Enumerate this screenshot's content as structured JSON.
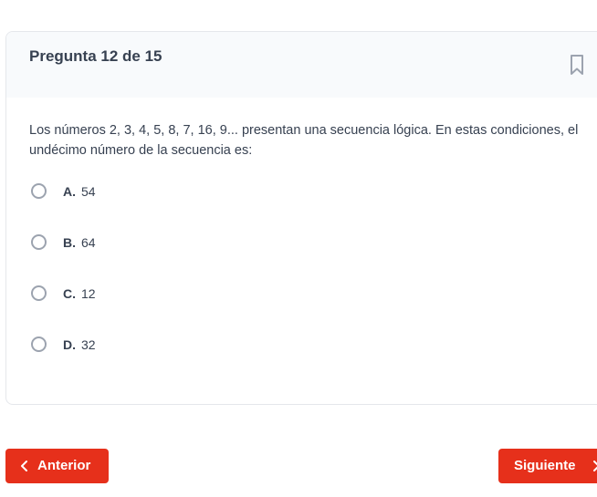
{
  "question_card": {
    "title": "Pregunta 12 de 15",
    "bookmark_icon": "bookmark-icon",
    "question_text": "Los números 2, 3, 4, 5, 8, 7, 16, 9... presentan una secuencia lógica. En estas condiciones, el undécimo número de la secuencia es:",
    "options": [
      {
        "letter": "A.",
        "text": "54"
      },
      {
        "letter": "B.",
        "text": "64"
      },
      {
        "letter": "C.",
        "text": "12"
      },
      {
        "letter": "D.",
        "text": "32"
      }
    ]
  },
  "navigation": {
    "prev_label": "Anterior",
    "prev_icon": "chevron-left-icon",
    "next_label": "Siguiente",
    "next_icon": "chevron-right-icon"
  },
  "colors": {
    "accent": "#e6301b",
    "header_bg": "#f8fafc",
    "text": "#374151"
  }
}
